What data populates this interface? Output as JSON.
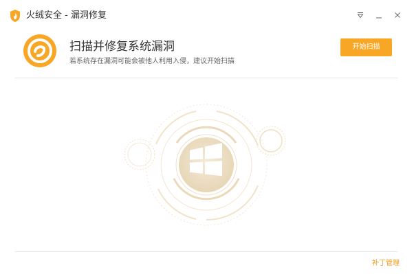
{
  "window": {
    "title": "火绒安全 - 漏洞修复",
    "icons": {
      "logo": "huorong-shield-logo-icon",
      "menu": "menu-dropdown-icon",
      "minimize": "minimize-icon",
      "close": "close-icon"
    }
  },
  "header": {
    "icon": "vulnerability-fix-icon",
    "title": "扫描并修复系统漏洞",
    "subtitle": "若系统存在漏洞可能会被他人利用入侵，建议开始扫描",
    "start_button": "开始扫描"
  },
  "main": {
    "graphic": "windows-logo-scan-icon"
  },
  "footer": {
    "patch_manage_link": "补丁管理"
  },
  "colors": {
    "accent": "#f8a626",
    "accent_dark": "#f39a1b",
    "ring_light": "#f3e8d2",
    "ring_dark": "#e8d4b0"
  }
}
